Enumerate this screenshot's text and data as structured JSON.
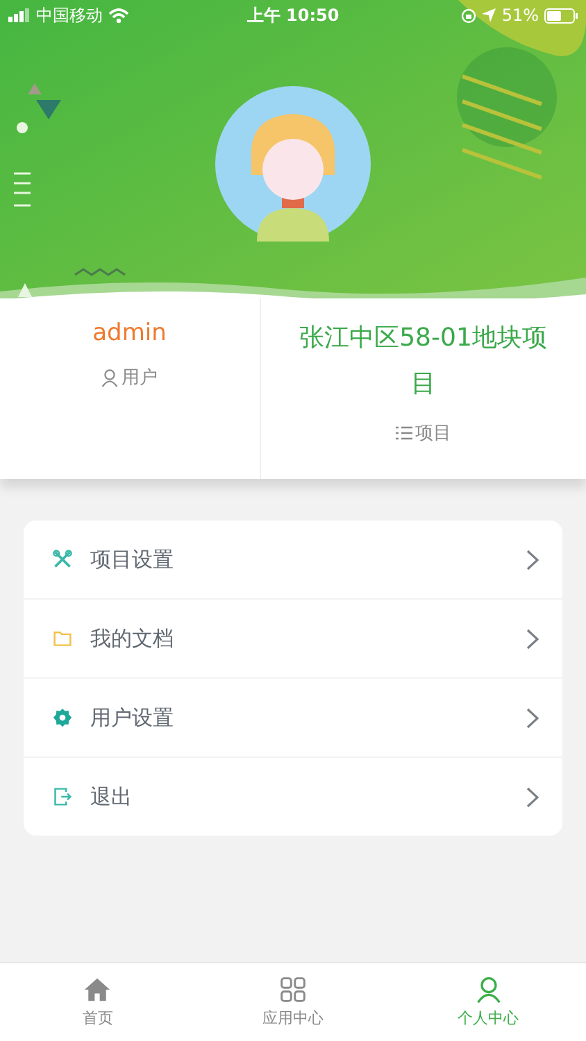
{
  "status_bar": {
    "carrier": "中国移动",
    "time": "上午 10:50",
    "battery": "51%"
  },
  "profile": {
    "user_name": "admin",
    "user_label": "用户",
    "project_name": "张江中区58-01地块项目",
    "project_label": "项目"
  },
  "menu": [
    {
      "label": "项目设置"
    },
    {
      "label": "我的文档"
    },
    {
      "label": "用户设置"
    },
    {
      "label": "退出"
    }
  ],
  "tabs": [
    {
      "label": "首页",
      "selected": false
    },
    {
      "label": "应用中心",
      "selected": false
    },
    {
      "label": "个人中心",
      "selected": true
    }
  ]
}
